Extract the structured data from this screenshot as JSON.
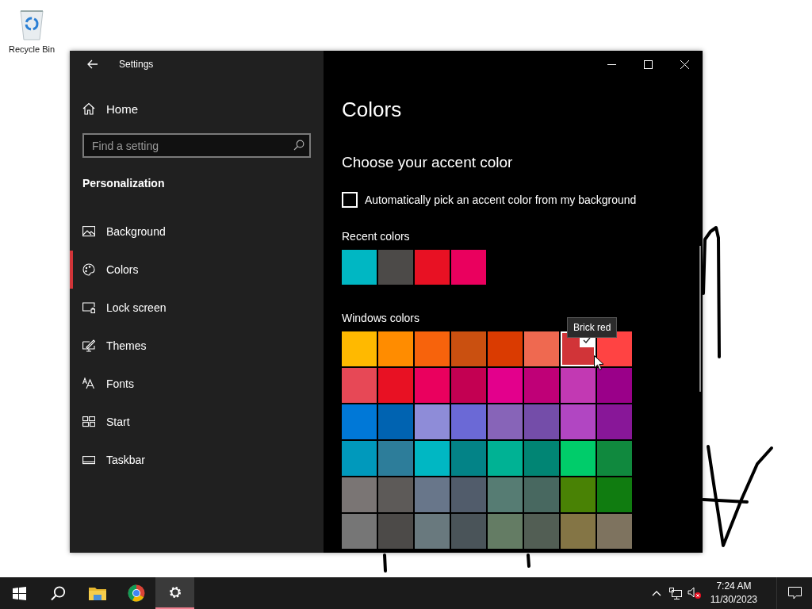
{
  "desktop": {
    "icons": [
      {
        "label": "Recycle Bin"
      }
    ]
  },
  "window": {
    "title": "Settings",
    "sidebar": {
      "home": "Home",
      "search": {
        "placeholder": "Find a setting"
      },
      "section": "Personalization",
      "items": [
        {
          "label": "Background",
          "kind": "background",
          "selected": false
        },
        {
          "label": "Colors",
          "kind": "colors",
          "selected": true
        },
        {
          "label": "Lock screen",
          "kind": "lock",
          "selected": false
        },
        {
          "label": "Themes",
          "kind": "themes",
          "selected": false
        },
        {
          "label": "Fonts",
          "kind": "fonts",
          "selected": false
        },
        {
          "label": "Start",
          "kind": "start",
          "selected": false
        },
        {
          "label": "Taskbar",
          "kind": "taskbar",
          "selected": false
        }
      ]
    },
    "content": {
      "title": "Colors",
      "heading": "Choose your accent color",
      "auto_pick": {
        "label": "Automatically pick an accent color from my background",
        "checked": false
      },
      "recent": {
        "label": "Recent colors",
        "swatches": [
          {
            "color": "#00b7c3"
          },
          {
            "color": "#4c4a48"
          },
          {
            "color": "#e81123"
          },
          {
            "color": "#ea005e"
          }
        ]
      },
      "windows_colors": {
        "label": "Windows colors",
        "swatches": [
          {
            "color": "#ffb900",
            "selected": false
          },
          {
            "color": "#ff8c00",
            "selected": false
          },
          {
            "color": "#f7630c",
            "selected": false
          },
          {
            "color": "#ca5010",
            "selected": false
          },
          {
            "color": "#da3b01",
            "selected": false
          },
          {
            "color": "#ef6950",
            "selected": false
          },
          {
            "color": "#d13438",
            "selected": true,
            "tooltip": "Brick red"
          },
          {
            "color": "#ff4343",
            "selected": false
          },
          {
            "color": "#e74856",
            "selected": false
          },
          {
            "color": "#e81123",
            "selected": false
          },
          {
            "color": "#ea005e",
            "selected": false
          },
          {
            "color": "#c30052",
            "selected": false
          },
          {
            "color": "#e3008c",
            "selected": false
          },
          {
            "color": "#bf0077",
            "selected": false
          },
          {
            "color": "#c239b3",
            "selected": false
          },
          {
            "color": "#9a0089",
            "selected": false
          },
          {
            "color": "#0078d7",
            "selected": false
          },
          {
            "color": "#0063b1",
            "selected": false
          },
          {
            "color": "#8e8cd8",
            "selected": false
          },
          {
            "color": "#6b69d6",
            "selected": false
          },
          {
            "color": "#8764b8",
            "selected": false
          },
          {
            "color": "#744da9",
            "selected": false
          },
          {
            "color": "#b146c2",
            "selected": false
          },
          {
            "color": "#881798",
            "selected": false
          },
          {
            "color": "#0099bc",
            "selected": false
          },
          {
            "color": "#2d7d9a",
            "selected": false
          },
          {
            "color": "#00b7c3",
            "selected": false
          },
          {
            "color": "#038387",
            "selected": false
          },
          {
            "color": "#00b294",
            "selected": false
          },
          {
            "color": "#018574",
            "selected": false
          },
          {
            "color": "#00cc6a",
            "selected": false
          },
          {
            "color": "#10893e",
            "selected": false
          },
          {
            "color": "#7a7574",
            "selected": false
          },
          {
            "color": "#5d5a58",
            "selected": false
          },
          {
            "color": "#68768a",
            "selected": false
          },
          {
            "color": "#515c6b",
            "selected": false
          },
          {
            "color": "#567c73",
            "selected": false
          },
          {
            "color": "#486860",
            "selected": false
          },
          {
            "color": "#498205",
            "selected": false
          },
          {
            "color": "#107c10",
            "selected": false
          },
          {
            "color": "#767676",
            "selected": false
          },
          {
            "color": "#4c4a48",
            "selected": false
          },
          {
            "color": "#69797e",
            "selected": false
          },
          {
            "color": "#4a5459",
            "selected": false
          },
          {
            "color": "#647c64",
            "selected": false
          },
          {
            "color": "#525e54",
            "selected": false
          },
          {
            "color": "#847545",
            "selected": false
          },
          {
            "color": "#7e735f",
            "selected": false
          }
        ]
      }
    }
  },
  "taskbar": {
    "apps": [
      {
        "kind": "start",
        "active": false
      },
      {
        "kind": "search",
        "active": false
      },
      {
        "kind": "explorer",
        "active": false
      },
      {
        "kind": "browser",
        "active": false
      },
      {
        "kind": "settings",
        "active": true
      }
    ],
    "clock": {
      "time": "7:24 AM",
      "date": "11/30/2023"
    }
  }
}
